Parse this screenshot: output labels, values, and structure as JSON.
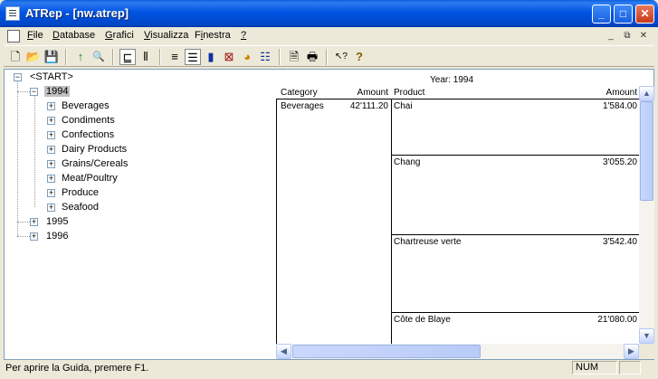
{
  "window": {
    "title": "ATRep - [nw.atrep]"
  },
  "menu": {
    "items": [
      {
        "label": "File"
      },
      {
        "label": "Database"
      },
      {
        "label": "Grafici"
      },
      {
        "label": "Visualizza"
      },
      {
        "label": "Finestra"
      },
      {
        "label": "?"
      }
    ],
    "mdi_minimize": "_",
    "mdi_restore": "⧉",
    "mdi_close": "✕"
  },
  "toolbar": {
    "tools": [
      {
        "icon": "new-document-icon",
        "glyph": "🗋"
      },
      {
        "icon": "open-folder-icon",
        "glyph": "📂"
      },
      {
        "icon": "save-icon",
        "glyph": "💾"
      },
      {
        "icon": "up-arrow-icon",
        "glyph": "↑"
      },
      {
        "icon": "find-icon",
        "glyph": "🔍"
      },
      {
        "icon": "tree-view-icon",
        "glyph": "⊑"
      },
      {
        "icon": "columns-icon",
        "glyph": "⫴"
      },
      {
        "icon": "list-icon",
        "glyph": "≡"
      },
      {
        "icon": "report-view-icon",
        "glyph": "☰"
      },
      {
        "icon": "bar-chart-icon",
        "glyph": "▮"
      },
      {
        "icon": "line-chart-icon",
        "glyph": "⊠"
      },
      {
        "icon": "pie-chart-icon",
        "glyph": "◕"
      },
      {
        "icon": "stacked-chart-icon",
        "glyph": "☷"
      },
      {
        "icon": "print-preview-icon",
        "glyph": "🗎"
      },
      {
        "icon": "print-icon",
        "glyph": "🖶"
      },
      {
        "icon": "context-help-icon",
        "glyph": "↖?"
      },
      {
        "icon": "help-icon",
        "glyph": "?"
      }
    ]
  },
  "tree": {
    "root": "<START>",
    "years": [
      {
        "label": "1994",
        "expanded": true,
        "selected": true,
        "children": [
          "Beverages",
          "Condiments",
          "Confections",
          "Dairy Products",
          "Grains/Cereals",
          "Meat/Poultry",
          "Produce",
          "Seafood"
        ]
      },
      {
        "label": "1995",
        "expanded": false
      },
      {
        "label": "1996",
        "expanded": false
      }
    ]
  },
  "report": {
    "header": "Year: 1994",
    "columns": [
      "Category",
      "Amount",
      "Product",
      "Amount"
    ],
    "category": {
      "name": "Beverages",
      "amount": "42'111.20"
    },
    "products": [
      {
        "name": "Chai",
        "amount": "1'584.00"
      },
      {
        "name": "Chang",
        "amount": "3'055.20"
      },
      {
        "name": "Chartreuse verte",
        "amount": "3'542.40"
      },
      {
        "name": "Côte de Blaye",
        "amount": "21'080.00"
      }
    ]
  },
  "statusbar": {
    "text": "Per aprire la Guida, premere F1.",
    "num": "NUM"
  }
}
